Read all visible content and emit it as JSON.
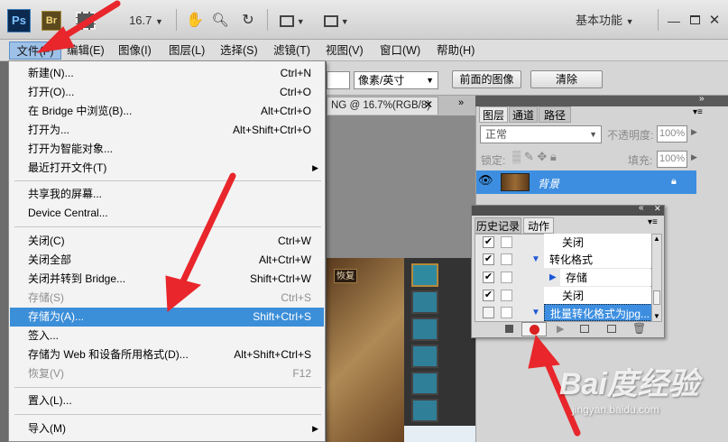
{
  "appbar": {
    "ps_logo": "Ps",
    "br_logo": "Br",
    "zoom": "16.7",
    "workspace": "基本功能"
  },
  "menubar": {
    "items": [
      "文件(F)",
      "编辑(E)",
      "图像(I)",
      "图层(L)",
      "选择(S)",
      "滤镜(T)",
      "视图(V)",
      "窗口(W)",
      "帮助(H)"
    ]
  },
  "options": {
    "unit": "像素/英寸",
    "front_image_label": "前面的图像",
    "clear_label": "清除"
  },
  "document": {
    "tab_title": "NG @ 16.7%(RGB/8)",
    "canvas_tag": "恢复"
  },
  "file_menu": {
    "items": [
      {
        "label": "新建(N)...",
        "shortcut": "Ctrl+N"
      },
      {
        "label": "打开(O)...",
        "shortcut": "Ctrl+O"
      },
      {
        "label": "在 Bridge 中浏览(B)...",
        "shortcut": "Alt+Ctrl+O"
      },
      {
        "label": "打开为...",
        "shortcut": "Alt+Shift+Ctrl+O"
      },
      {
        "label": "打开为智能对象...",
        "shortcut": ""
      },
      {
        "label": "最近打开文件(T)",
        "shortcut": ""
      },
      {
        "label": "共享我的屏幕...",
        "shortcut": ""
      },
      {
        "label": "Device Central...",
        "shortcut": ""
      },
      {
        "label": "关闭(C)",
        "shortcut": "Ctrl+W"
      },
      {
        "label": "关闭全部",
        "shortcut": "Alt+Ctrl+W"
      },
      {
        "label": "关闭并转到 Bridge...",
        "shortcut": "Shift+Ctrl+W"
      },
      {
        "label": "存储(S)",
        "shortcut": "Ctrl+S"
      },
      {
        "label": "存储为(A)...",
        "shortcut": "Shift+Ctrl+S"
      },
      {
        "label": "签入...",
        "shortcut": ""
      },
      {
        "label": "存储为 Web 和设备所用格式(D)...",
        "shortcut": "Alt+Shift+Ctrl+S"
      },
      {
        "label": "恢复(V)",
        "shortcut": "F12"
      },
      {
        "label": "置入(L)...",
        "shortcut": ""
      },
      {
        "label": "导入(M)",
        "shortcut": ""
      }
    ]
  },
  "layers_panel": {
    "tabs": [
      "图层",
      "通道",
      "路径"
    ],
    "blend_mode": "正常",
    "opacity_label": "不透明度:",
    "opacity_value": "100%",
    "lock_label": "锁定:",
    "fill_label": "填充:",
    "fill_value": "100%",
    "layer_name": "背景"
  },
  "actions_panel": {
    "tabs": [
      "历史记录",
      "动作"
    ],
    "rows": [
      "关闭",
      "转化格式",
      "存储",
      "关闭",
      "批量转化格式为jpg..."
    ]
  },
  "watermark": {
    "brand": "Bai度经验",
    "url": "jingyan.baidu.com"
  },
  "colors": {
    "highlight": "#3b8ed8",
    "arrow": "#e8262b",
    "record": "#d92121"
  }
}
